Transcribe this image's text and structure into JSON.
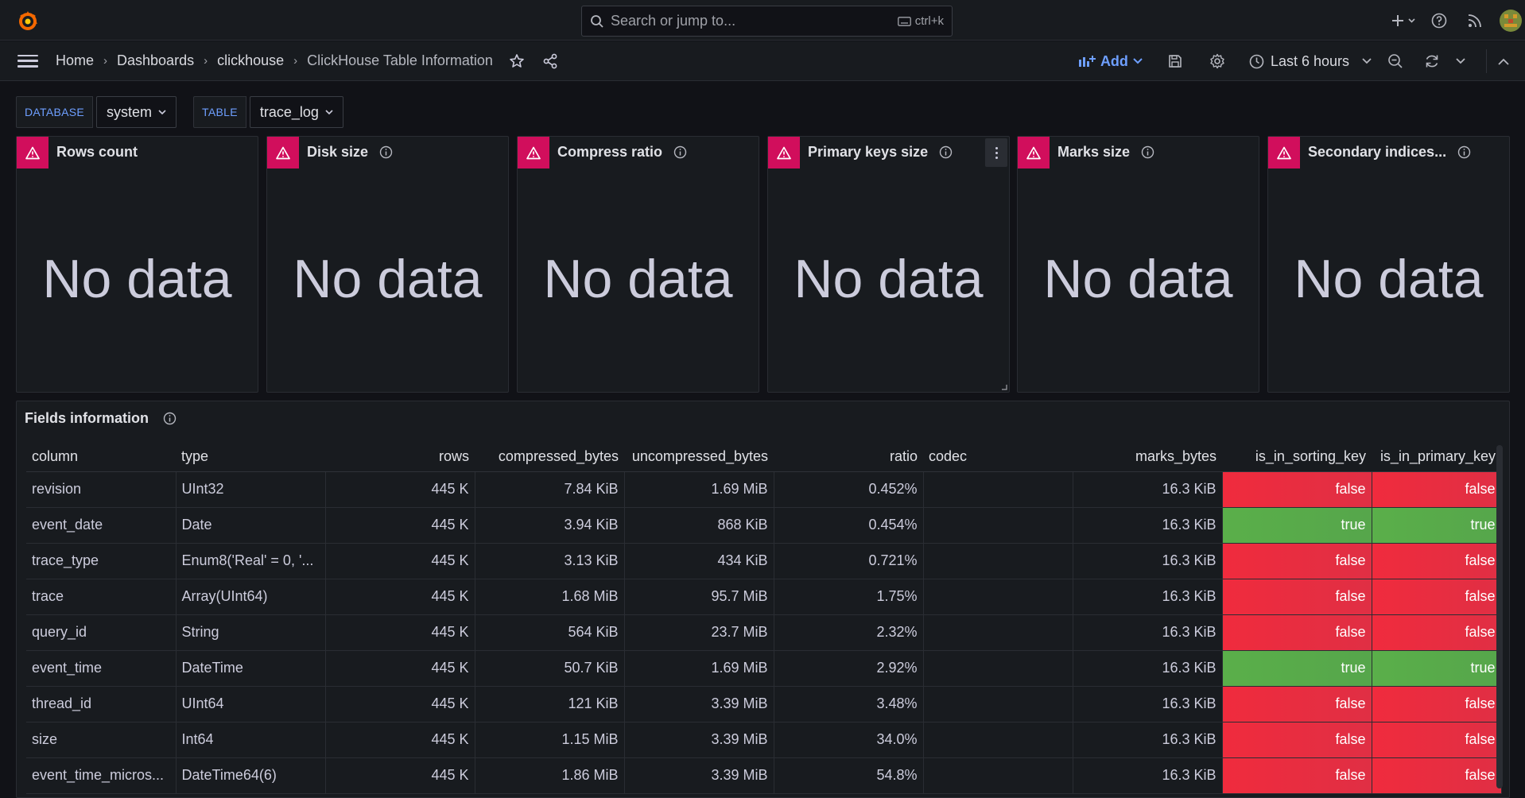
{
  "topbar": {
    "search_placeholder": "Search or jump to...",
    "search_shortcut": "ctrl+k"
  },
  "nav": {
    "breadcrumbs": [
      "Home",
      "Dashboards",
      "clickhouse"
    ],
    "current": "ClickHouse Table Information",
    "add_label": "Add",
    "time_range": "Last 6 hours"
  },
  "variables": [
    {
      "label": "DATABASE",
      "value": "system"
    },
    {
      "label": "TABLE",
      "value": "trace_log"
    }
  ],
  "stat_panels": [
    {
      "title": "Rows count",
      "body": "No data"
    },
    {
      "title": "Disk size",
      "body": "No data"
    },
    {
      "title": "Compress ratio",
      "body": "No data"
    },
    {
      "title": "Primary keys size",
      "body": "No data"
    },
    {
      "title": "Marks size",
      "body": "No data"
    },
    {
      "title": "Secondary indices...",
      "body": "No data"
    }
  ],
  "table_panel": {
    "title": "Fields information",
    "columns": [
      "column",
      "type",
      "rows",
      "compressed_bytes",
      "uncompressed_bytes",
      "ratio",
      "codec",
      "marks_bytes",
      "is_in_sorting_key",
      "is_in_primary_key"
    ],
    "rows": [
      {
        "column": "revision",
        "type": "UInt32",
        "rows": "445 K",
        "compressed": "7.84 KiB",
        "uncompressed": "1.69 MiB",
        "ratio": "0.452%",
        "codec": "",
        "marks": "16.3 KiB",
        "sorting": "false",
        "primary": "false"
      },
      {
        "column": "event_date",
        "type": "Date",
        "rows": "445 K",
        "compressed": "3.94 KiB",
        "uncompressed": "868 KiB",
        "ratio": "0.454%",
        "codec": "",
        "marks": "16.3 KiB",
        "sorting": "true",
        "primary": "true"
      },
      {
        "column": "trace_type",
        "type": "Enum8('Real' = 0, '...",
        "rows": "445 K",
        "compressed": "3.13 KiB",
        "uncompressed": "434 KiB",
        "ratio": "0.721%",
        "codec": "",
        "marks": "16.3 KiB",
        "sorting": "false",
        "primary": "false"
      },
      {
        "column": "trace",
        "type": "Array(UInt64)",
        "rows": "445 K",
        "compressed": "1.68 MiB",
        "uncompressed": "95.7 MiB",
        "ratio": "1.75%",
        "codec": "",
        "marks": "16.3 KiB",
        "sorting": "false",
        "primary": "false"
      },
      {
        "column": "query_id",
        "type": "String",
        "rows": "445 K",
        "compressed": "564 KiB",
        "uncompressed": "23.7 MiB",
        "ratio": "2.32%",
        "codec": "",
        "marks": "16.3 KiB",
        "sorting": "false",
        "primary": "false"
      },
      {
        "column": "event_time",
        "type": "DateTime",
        "rows": "445 K",
        "compressed": "50.7 KiB",
        "uncompressed": "1.69 MiB",
        "ratio": "2.92%",
        "codec": "",
        "marks": "16.3 KiB",
        "sorting": "true",
        "primary": "true"
      },
      {
        "column": "thread_id",
        "type": "UInt64",
        "rows": "445 K",
        "compressed": "121 KiB",
        "uncompressed": "3.39 MiB",
        "ratio": "3.48%",
        "codec": "",
        "marks": "16.3 KiB",
        "sorting": "false",
        "primary": "false"
      },
      {
        "column": "size",
        "type": "Int64",
        "rows": "445 K",
        "compressed": "1.15 MiB",
        "uncompressed": "3.39 MiB",
        "ratio": "34.0%",
        "codec": "",
        "marks": "16.3 KiB",
        "sorting": "false",
        "primary": "false"
      },
      {
        "column": "event_time_micros...",
        "type": "DateTime64(6)",
        "rows": "445 K",
        "compressed": "1.86 MiB",
        "uncompressed": "3.39 MiB",
        "ratio": "54.8%",
        "codec": "",
        "marks": "16.3 KiB",
        "sorting": "false",
        "primary": "false"
      }
    ]
  },
  "colors": {
    "warning": "#d10e5c",
    "false_cell": "#f02b3d",
    "true_cell": "#5aaf4a",
    "link_blue": "#6e9fff"
  }
}
